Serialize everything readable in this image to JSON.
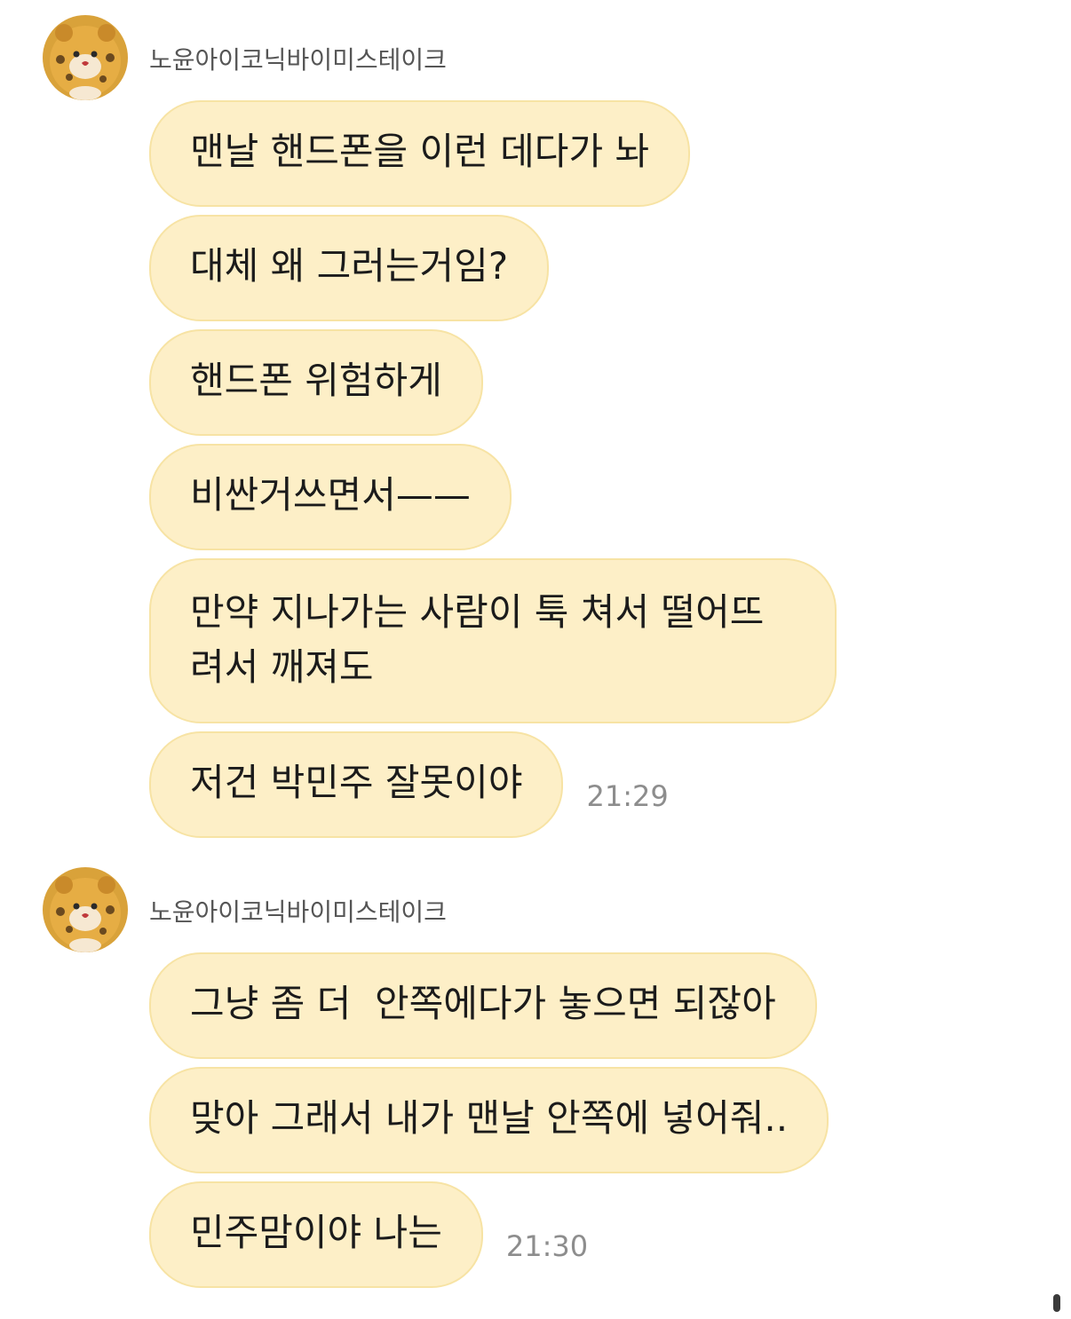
{
  "groups": [
    {
      "sender": "노윤아이코닉바이미스테이크",
      "avatar_icon": "tiger-plush-avatar-icon",
      "messages": [
        "맨날 핸드폰을 이런 데다가 놔",
        "대체 왜 그러는거임?",
        "핸드폰 위험하게",
        "비싼거쓰면서——",
        "만약 지나가는 사람이 툭 쳐서 떨어뜨려서 깨져도",
        "저건 박민주 잘못이야"
      ],
      "time": "21:29"
    },
    {
      "sender": "노윤아이코닉바이미스테이크",
      "avatar_icon": "tiger-plush-avatar-icon",
      "messages": [
        "그냥 좀 더  안쪽에다가 놓으면 되잖아",
        "맞아 그래서 내가 맨날 안쪽에 넣어줘..",
        "민주맘이야 나는"
      ],
      "time": "21:30"
    }
  ],
  "colors": {
    "bubble": "#fdefc7",
    "bubble_border": "#f7e3a4",
    "text": "#1b1b1b",
    "sender": "#555555",
    "time": "#8d8d8d",
    "background": "#ffffff"
  }
}
